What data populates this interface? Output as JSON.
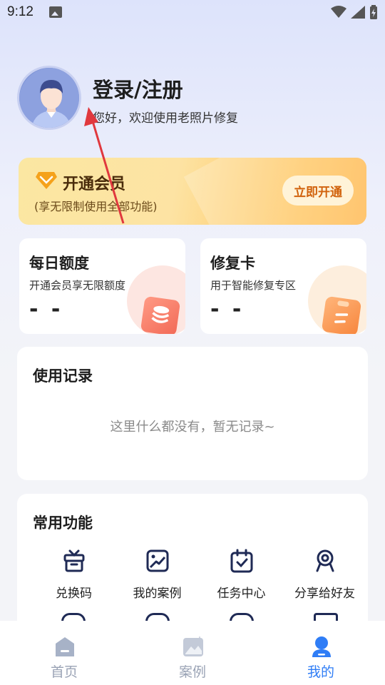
{
  "status_bar": {
    "time": "9:12"
  },
  "profile": {
    "login_title": "登录/注册",
    "subtitle": "您好，欢迎使用老照片修复"
  },
  "vip": {
    "title": "开通会员",
    "subtitle": "(享无限制使用全部功能)",
    "button": "立即开通"
  },
  "cards": [
    {
      "title": "每日额度",
      "desc": "开通会员享无限额度",
      "value": "- -"
    },
    {
      "title": "修复卡",
      "desc": "用于智能修复专区",
      "value": "- -"
    }
  ],
  "records": {
    "title": "使用记录",
    "empty": "这里什么都没有，暂无记录~"
  },
  "functions": {
    "title": "常用功能",
    "items": [
      {
        "label": "兑换码",
        "icon": "gift-box-icon"
      },
      {
        "label": "我的案例",
        "icon": "image-frame-icon"
      },
      {
        "label": "任务中心",
        "icon": "calendar-check-icon"
      },
      {
        "label": "分享给好友",
        "icon": "share-ribbon-icon"
      }
    ]
  },
  "bottom_nav": [
    {
      "label": "首页",
      "icon": "home-icon",
      "active": false
    },
    {
      "label": "案例",
      "icon": "gallery-icon",
      "active": false
    },
    {
      "label": "我的",
      "icon": "user-icon",
      "active": true
    }
  ],
  "colors": {
    "accent": "#2f7df6",
    "vip_text": "#4a2c0b",
    "vip_button_text": "#d1620c",
    "annotation_arrow": "#e0383e"
  }
}
